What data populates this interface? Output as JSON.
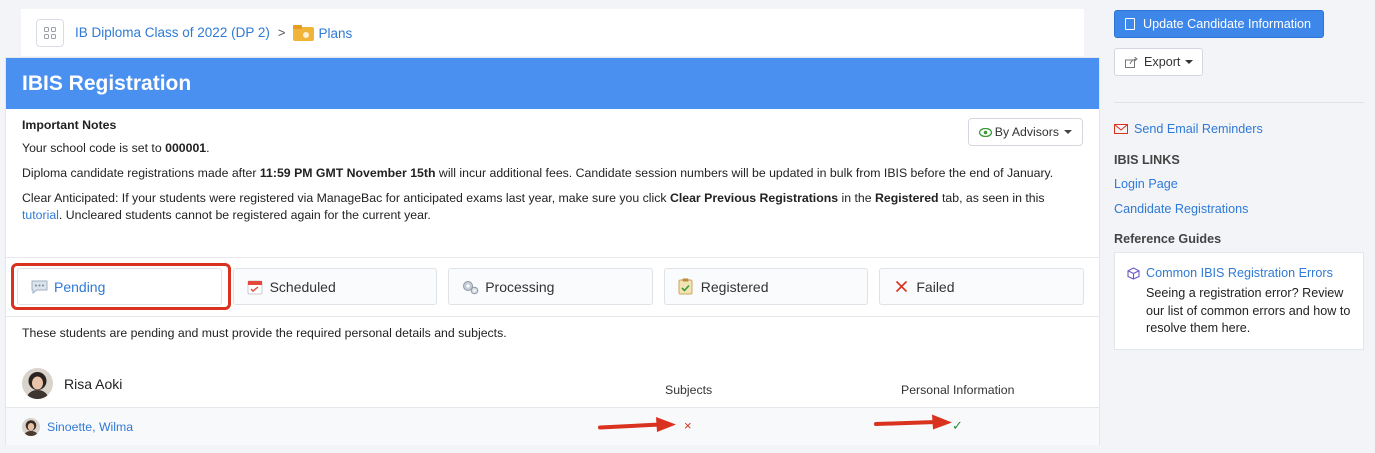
{
  "breadcrumb": {
    "class_name": "IB Diploma Class of 2022 (DP 2)",
    "separator": ">",
    "plans": "Plans"
  },
  "page": {
    "title": "IBIS Registration"
  },
  "notes": {
    "heading": "Important Notes",
    "school_code_prefix": "Your school code is set to ",
    "school_code": "000001",
    "school_code_suffix": ".",
    "deadline_prefix": "Diploma candidate registrations made after ",
    "deadline": "11:59 PM GMT November 15th",
    "deadline_suffix": " will incur additional fees. Candidate session numbers will be updated in bulk from IBIS before the end of January.",
    "clear_prefix": "Clear Anticipated: If your students were registered via ManageBac for anticipated exams last year, make sure you click ",
    "clear_bold": "Clear Previous Registrations",
    "clear_mid": " in the ",
    "clear_tab": "Registered",
    "clear_mid2": " tab, as seen in this ",
    "tutorial_link": "tutorial",
    "clear_suffix": ". Uncleared students cannot be registered again for the current year."
  },
  "advisors_dropdown": "By Advisors",
  "tabs": [
    {
      "label": "Pending",
      "icon": "speech-bubble-icon"
    },
    {
      "label": "Scheduled",
      "icon": "calendar-icon"
    },
    {
      "label": "Processing",
      "icon": "gears-icon"
    },
    {
      "label": "Registered",
      "icon": "clipboard-check-icon"
    },
    {
      "label": "Failed",
      "icon": "x-icon"
    }
  ],
  "pending_description": "These students are pending and must provide the required personal details and subjects.",
  "advisor": {
    "name": "Risa Aoki"
  },
  "columns": {
    "subjects": "Subjects",
    "personal_info": "Personal Information"
  },
  "students": [
    {
      "name": "Sinoette, Wilma",
      "subjects_status": "×",
      "personal_status": "✓"
    }
  ],
  "sidebar": {
    "update_button": "Update Candidate Information",
    "export_button": "Export",
    "send_reminders": "Send Email Reminders",
    "ibis_links_heading": "IBIS LINKS",
    "login_page": "Login Page",
    "candidate_registrations": "Candidate Registrations",
    "reference_heading": "Reference Guides",
    "guide_title": "Common IBIS Registration Errors",
    "guide_text": "Seeing a registration error? Review our list of common errors and how to resolve them here."
  },
  "colors": {
    "header_blue": "#4a90f0",
    "link_blue": "#2f7ad6",
    "error_red": "#d9321f",
    "success_green": "#2e8b3e"
  }
}
